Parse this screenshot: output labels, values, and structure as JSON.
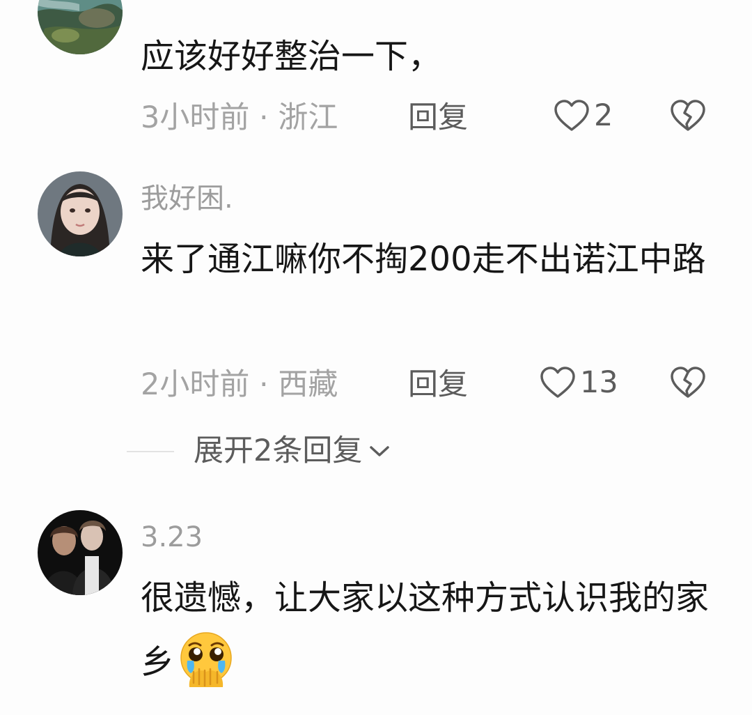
{
  "comments": [
    {
      "username": "",
      "text": "应该好好整治一下，",
      "meta": "3小时前 · 浙江",
      "reply_label": "回复",
      "like_count": "2",
      "avatar": "rocky-shore-photo"
    },
    {
      "username": "我好困.",
      "text": "来了通江嘛你不掏200走不出诺江中路",
      "meta": "2小时前 · 西藏",
      "reply_label": "回复",
      "like_count": "13",
      "avatar": "girl-portrait-photo"
    },
    {
      "username": "3.23",
      "text": "很遗憾，让大家以这种方式认识我的家乡",
      "emoji": "pleading-hands-over-mouth-emoji",
      "avatar": "couple-photo"
    }
  ],
  "expand_replies": {
    "label": "展开2条回复"
  },
  "icons": {
    "like": "heart-outline-icon",
    "dislike": "broken-heart-icon",
    "expand": "chevron-down-icon"
  },
  "colors": {
    "background": "#fdfdfd",
    "primary_text": "#161616",
    "secondary_text": "#a3a3a3",
    "action_text": "#5c5c5c"
  }
}
